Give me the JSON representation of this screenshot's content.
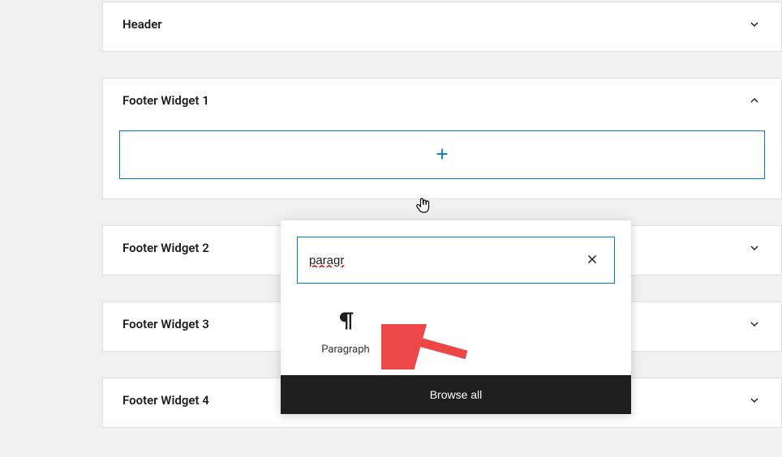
{
  "widget_areas": {
    "header": {
      "label": "Header",
      "expanded": false
    },
    "footer1": {
      "label": "Footer Widget 1",
      "expanded": true
    },
    "footer2": {
      "label": "Footer Widget 2",
      "expanded": false
    },
    "footer3": {
      "label": "Footer Widget 3",
      "expanded": false
    },
    "footer4": {
      "label": "Footer Widget 4",
      "expanded": false
    }
  },
  "inserter": {
    "search_value": "paragr",
    "search_placeholder": "Search",
    "results": {
      "paragraph": {
        "label": "Paragraph",
        "icon": "pilcrow"
      }
    },
    "browse_all_label": "Browse all"
  }
}
